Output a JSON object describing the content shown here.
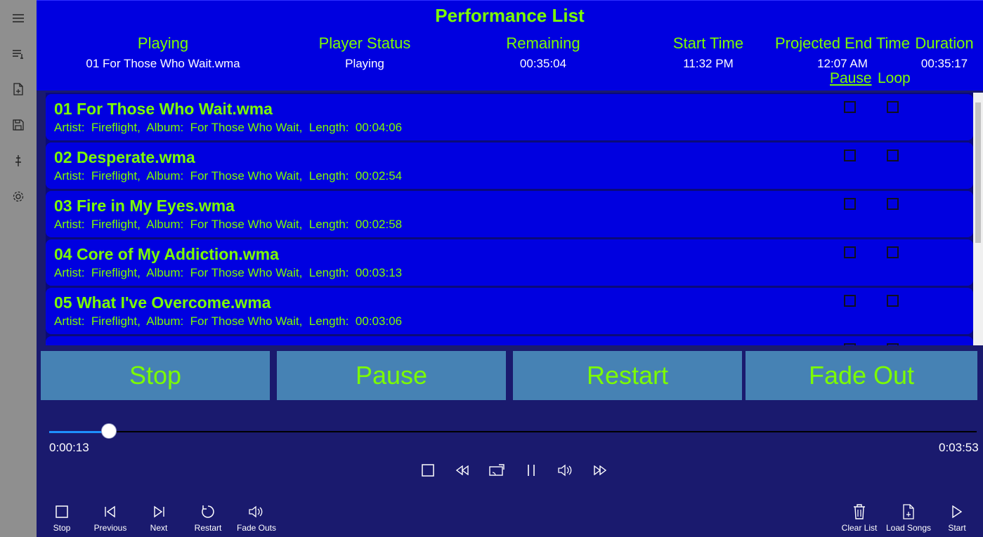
{
  "header": {
    "title": "Performance List",
    "columns": [
      {
        "label": "Playing",
        "value": "01 For Those Who Wait.wma"
      },
      {
        "label": "Player Status",
        "value": "Playing"
      },
      {
        "label": "Remaining",
        "value": "00:35:04"
      },
      {
        "label": "Start Time",
        "value": "11:32 PM"
      },
      {
        "label": "Projected End Time",
        "value": "12:07 AM"
      },
      {
        "label": "Duration",
        "value": "00:35:17"
      }
    ],
    "pause_label": "Pause",
    "loop_label": "Loop"
  },
  "songs": [
    {
      "title": "01 For Those Who Wait.wma",
      "meta": "Artist:  Fireflight,  Album:  For Those Who Wait,  Length:  00:04:06"
    },
    {
      "title": "02 Desperate.wma",
      "meta": "Artist:  Fireflight,  Album:  For Those Who Wait,  Length:  00:02:54"
    },
    {
      "title": "03 Fire in My Eyes.wma",
      "meta": "Artist:  Fireflight,  Album:  For Those Who Wait,  Length:  00:02:58"
    },
    {
      "title": "04 Core of My Addiction.wma",
      "meta": "Artist:  Fireflight,  Album:  For Those Who Wait,  Length:  00:03:13"
    },
    {
      "title": "05 What I've Overcome.wma",
      "meta": "Artist:  Fireflight,  Album:  For Those Who Wait,  Length:  00:03:06"
    }
  ],
  "big_buttons": {
    "stop": "Stop",
    "pause": "Pause",
    "restart": "Restart",
    "fade_out": "Fade Out"
  },
  "player": {
    "elapsed": "0:00:13",
    "total": "0:03:53",
    "progress_fraction": 0.056
  },
  "bottom_bar": {
    "stop": "Stop",
    "previous": "Previous",
    "next": "Next",
    "restart": "Restart",
    "fade_outs": "Fade Outs",
    "clear_list": "Clear List",
    "load_songs": "Load Songs",
    "start": "Start"
  },
  "colors": {
    "header_bg": "#0000e0",
    "accent_text": "#7cfc00",
    "button_bg": "#4682b4",
    "page_bg": "#1a1a6e",
    "sidebar_bg": "#8f8f8f"
  }
}
